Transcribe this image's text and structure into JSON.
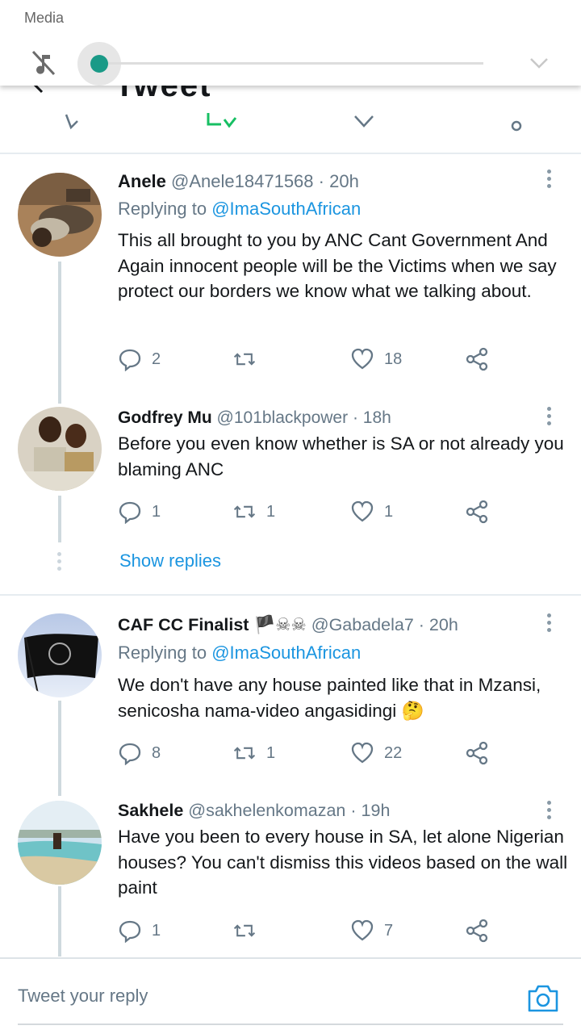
{
  "media_panel": {
    "label": "Media",
    "volume_level": 0.0,
    "mute_icon": "music-off-icon",
    "expand_icon": "chevron-down-icon"
  },
  "header": {
    "title": "Tweet",
    "back_icon": "back-arrow-icon"
  },
  "colors": {
    "accent": "#1b95e0",
    "slider": "#1a9a87",
    "muted_text": "#657786",
    "retweet_green": "#17bf63"
  },
  "tweets": [
    {
      "name": "Anele",
      "handle": "@Anele18471568",
      "time": "20h",
      "replying_label": "Replying to",
      "replying_to": "@ImaSouthAfrican",
      "text": "This all brought to you by ANC Cant Government And Again innocent people will be the Victims when we say protect our borders we know what we talking about.",
      "replies": "2",
      "retweets": "",
      "likes": "18"
    },
    {
      "name": "Godfrey Mu",
      "handle": "@101blackpower",
      "time": "18h",
      "text": "Before you even know whether is SA or not already you blaming ANC",
      "replies": "1",
      "retweets": "1",
      "likes": "1"
    },
    {
      "name": "CAF CC Finalist",
      "name_emoji": "🏴☠☠",
      "handle": "@Gabadela7",
      "time": "20h",
      "replying_label": "Replying to",
      "replying_to": "@ImaSouthAfrican",
      "text": "We don't have any house painted like that in Mzansi, senicosha nama-video angasidingi 🤔",
      "replies": "8",
      "retweets": "1",
      "likes": "22"
    },
    {
      "name": "Sakhele",
      "handle": "@sakhelenkomazan",
      "time": "19h",
      "text": "Have you been to every house in SA, let alone Nigerian houses? You can't dismiss this videos based on the wall paint",
      "replies": "1",
      "retweets": "",
      "likes": "7"
    }
  ],
  "show_replies": "Show replies",
  "reply_bar": {
    "placeholder": "Tweet your reply",
    "camera_icon": "camera-icon"
  }
}
